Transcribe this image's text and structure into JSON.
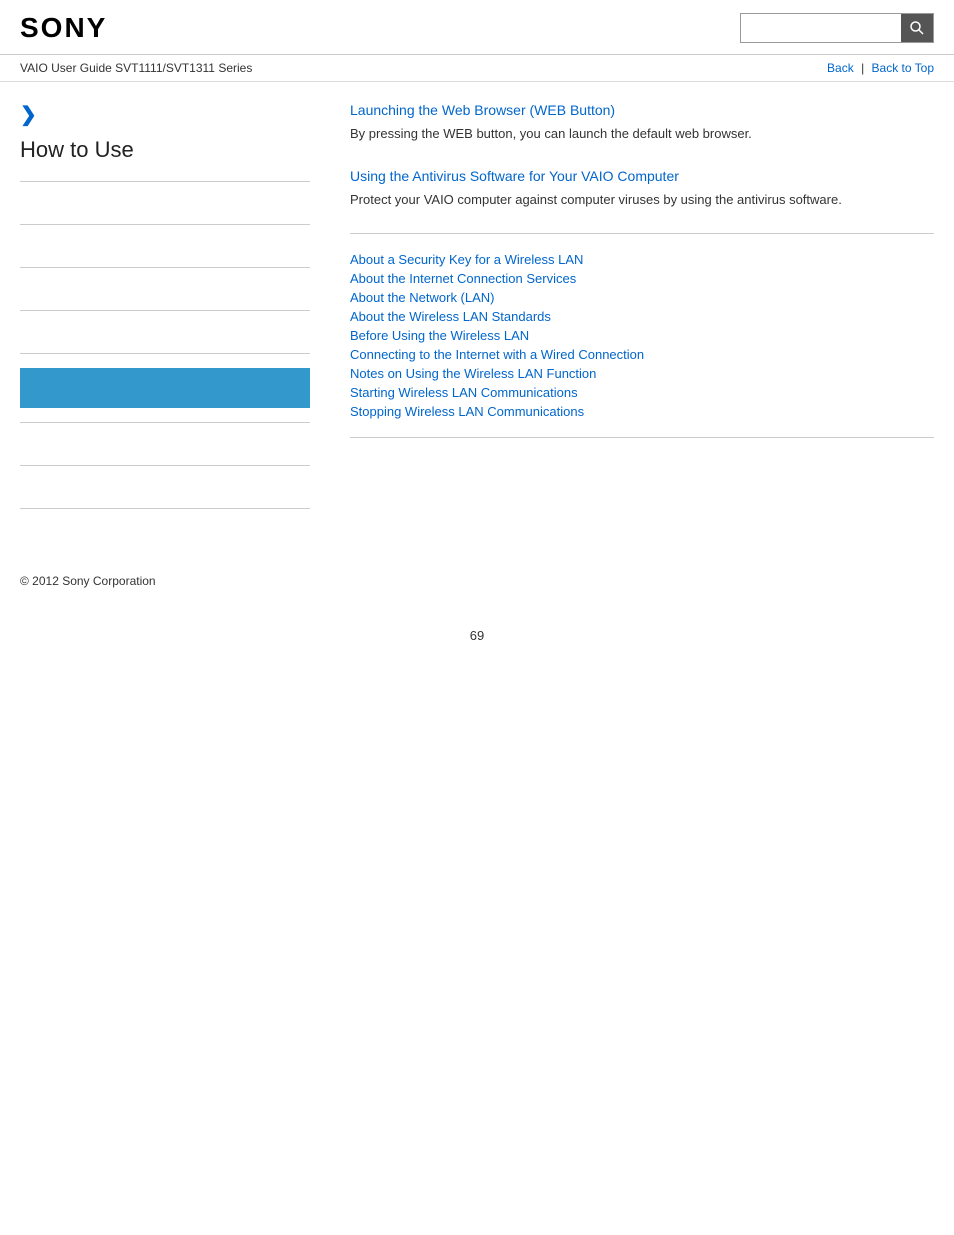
{
  "header": {
    "logo": "SONY",
    "search_placeholder": ""
  },
  "breadcrumb": {
    "guide_title": "VAIO User Guide SVT1111/SVT1311 Series",
    "back_label": "Back",
    "back_to_top_label": "Back to Top"
  },
  "sidebar": {
    "chevron": "❯",
    "section_title": "How to Use"
  },
  "content": {
    "section1": {
      "title": "Launching the Web Browser (WEB Button)",
      "description": "By pressing the WEB button, you can launch the default web browser."
    },
    "section2": {
      "title": "Using the Antivirus Software for Your VAIO Computer",
      "description": "Protect your VAIO computer against computer viruses by using the antivirus software."
    },
    "links": [
      "About a Security Key for a Wireless LAN",
      "About the Internet Connection Services",
      "About the Network (LAN)",
      "About the Wireless LAN Standards",
      "Before Using the Wireless LAN",
      "Connecting to the Internet with a Wired Connection",
      "Notes on Using the Wireless LAN Function",
      "Starting Wireless LAN Communications",
      "Stopping Wireless LAN Communications"
    ]
  },
  "footer": {
    "copyright": "© 2012 Sony Corporation"
  },
  "page_number": "69",
  "icons": {
    "search": "🔍"
  }
}
